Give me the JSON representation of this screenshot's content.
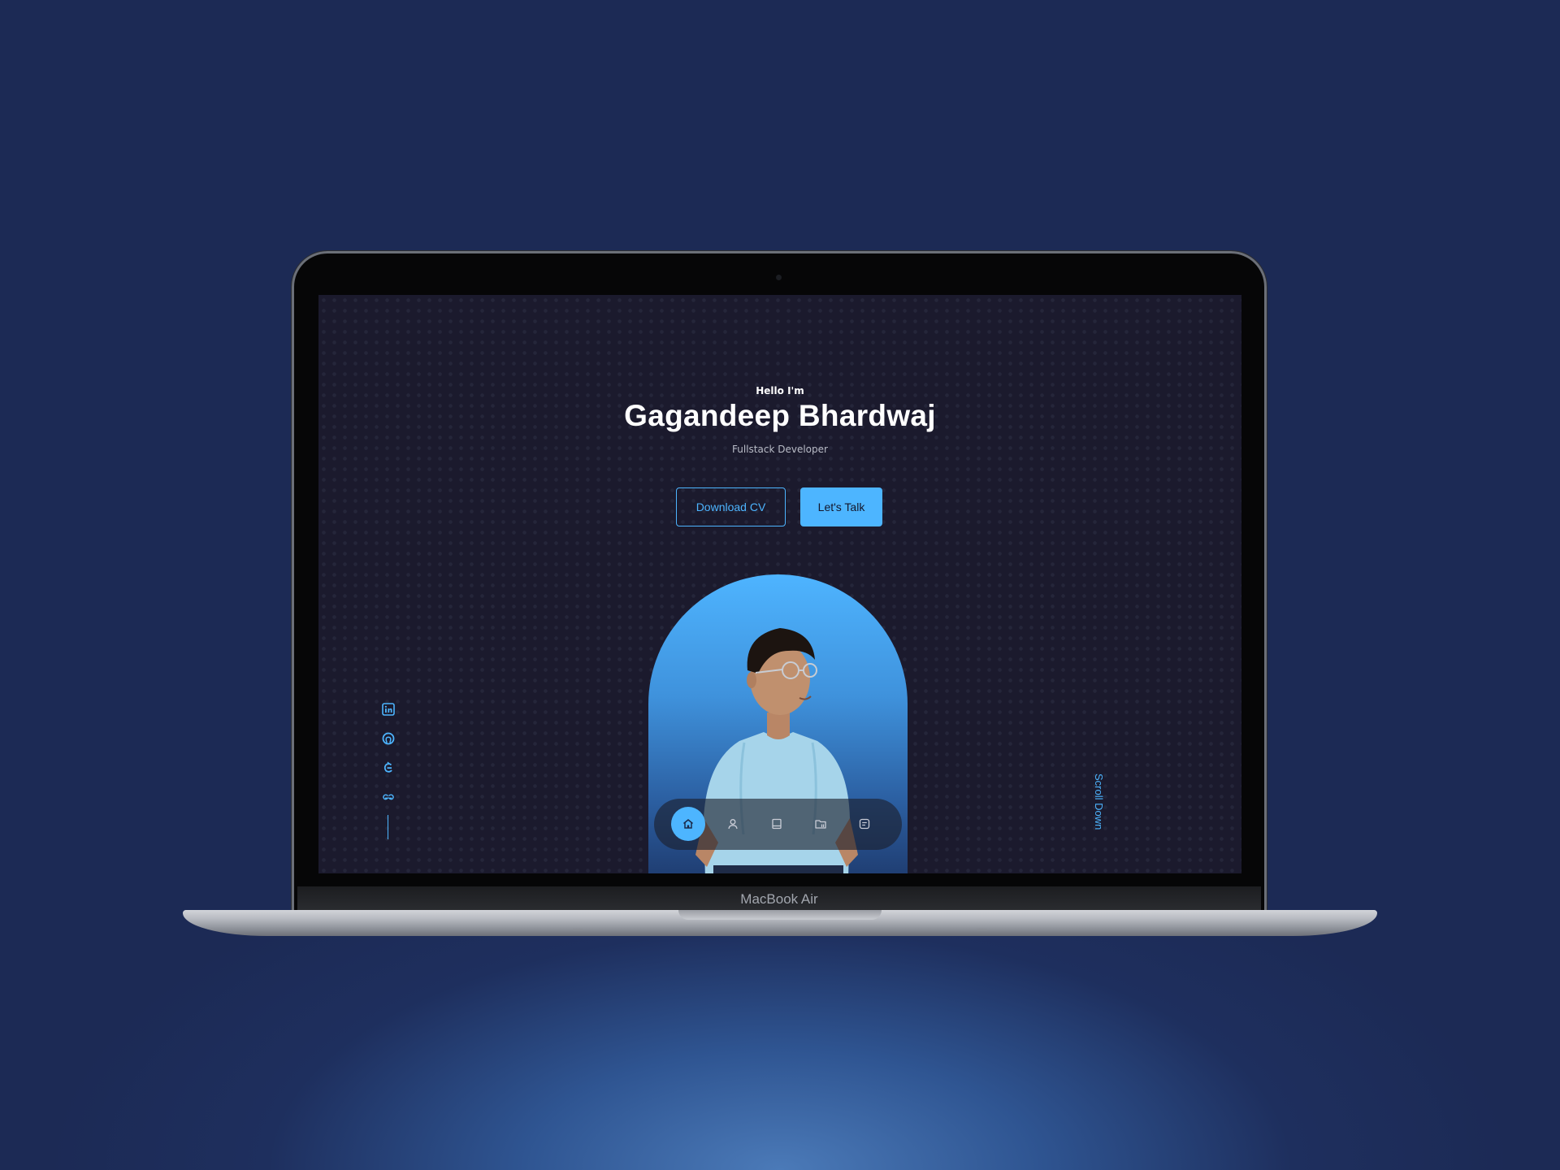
{
  "device": {
    "brand_label": "MacBook Air"
  },
  "hero": {
    "greeting": "Hello I'm",
    "name": "Gagandeep Bhardwaj",
    "role": "Fullstack Developer",
    "download_cv_label": "Download CV",
    "lets_talk_label": "Let's Talk"
  },
  "socials": [
    {
      "icon": "linkedin-icon"
    },
    {
      "icon": "github-icon"
    },
    {
      "icon": "code-icon"
    },
    {
      "icon": "geeksforgeeks-icon"
    }
  ],
  "scroll_label": "Scroll Down",
  "nav": {
    "items": [
      {
        "icon": "home-icon",
        "active": true
      },
      {
        "icon": "user-icon",
        "active": false
      },
      {
        "icon": "book-icon",
        "active": false
      },
      {
        "icon": "folder-icon",
        "active": false
      },
      {
        "icon": "message-icon",
        "active": false
      }
    ]
  },
  "colors": {
    "accent": "#4db5ff",
    "screen_background": "#1b1a2d",
    "page_background": "#1e2a56"
  }
}
